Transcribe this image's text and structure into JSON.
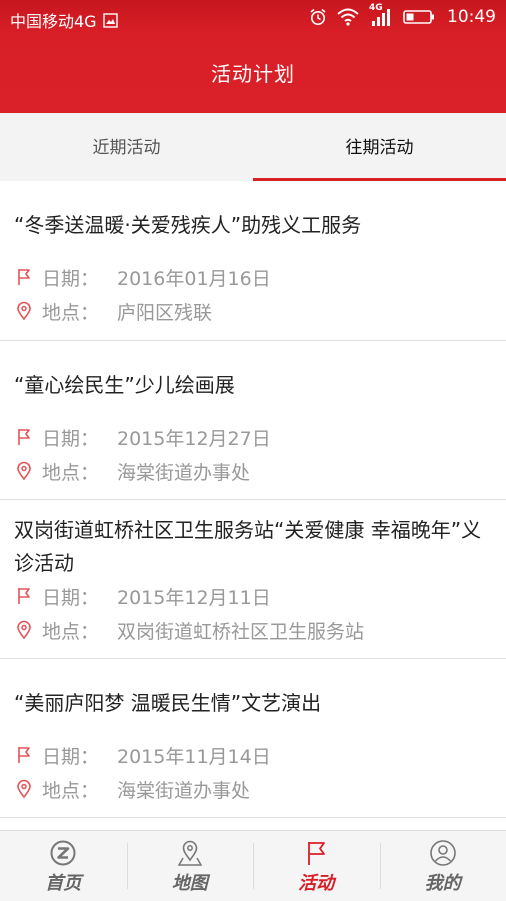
{
  "status_bar": {
    "carrier": "中国移动4G",
    "network": "4G",
    "time": "10:49"
  },
  "header": {
    "title": "活动计划"
  },
  "tabs": [
    {
      "label": "近期活动",
      "active": false
    },
    {
      "label": "往期活动",
      "active": true
    }
  ],
  "events": [
    {
      "title": "“冬季送温暖·关爱残疾人”助残义工服务",
      "date_label": "日期：",
      "date": "2016年01月16日",
      "location_label": "地点：",
      "location": "庐阳区残联"
    },
    {
      "title": "“童心绘民生”少儿绘画展",
      "date_label": "日期：",
      "date": "2015年12月27日",
      "location_label": "地点：",
      "location": "海棠街道办事处"
    },
    {
      "title": "双岗街道虹桥社区卫生服务站“关爱健康 幸福晚年”义诊活动",
      "date_label": "日期：",
      "date": "2015年12月11日",
      "location_label": "地点：",
      "location": "双岗街道虹桥社区卫生服务站"
    },
    {
      "title": "“美丽庐阳梦 温暖民生情”文艺演出",
      "date_label": "日期：",
      "date": "2015年11月14日",
      "location_label": "地点：",
      "location": "海棠街道办事处"
    }
  ],
  "bottom_nav": [
    {
      "label": "首页",
      "icon": "home-logo-icon",
      "active": false
    },
    {
      "label": "地图",
      "icon": "map-pin-icon",
      "active": false
    },
    {
      "label": "活动",
      "icon": "flag-icon",
      "active": true
    },
    {
      "label": "我的",
      "icon": "user-icon",
      "active": false
    }
  ],
  "colors": {
    "brand_red": "#d81f27",
    "muted_text": "#999999",
    "tab_bg": "#f3f3f3"
  }
}
